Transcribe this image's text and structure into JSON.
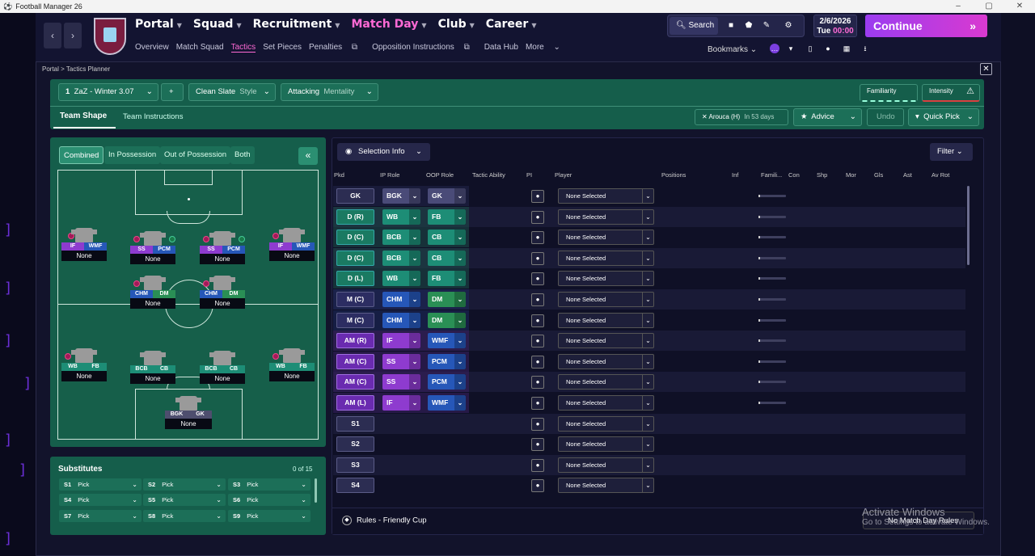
{
  "window": {
    "title": "Football Manager 26",
    "min": "–",
    "max": "▢",
    "close": "✕"
  },
  "nav": {
    "back": "‹",
    "fwd": "›",
    "main": [
      "Portal",
      "Squad",
      "Recruitment",
      "Match Day",
      "Club",
      "Career"
    ],
    "sub": [
      "Overview",
      "Match Squad",
      "Tactics",
      "Set Pieces",
      "Penalties",
      "Opposition Instructions",
      "Data Hub",
      "More"
    ]
  },
  "top": {
    "search": "Search",
    "date": "2/6/2026",
    "day": "Tue",
    "time": "00:00",
    "continue": "Continue",
    "bookmarks": "Bookmarks"
  },
  "breadcrumb": "Portal  >  Tactics Planner",
  "tactic": {
    "slot": "1",
    "name": "ZaZ - Winter 3.07",
    "add": "+",
    "style_value": "Clean Slate",
    "style_label": "Style",
    "mentality_value": "Attacking",
    "mentality_label": "Mentality",
    "familiarity": "Familiarity",
    "intensity": "Intensity"
  },
  "tabs": {
    "shape": "Team Shape",
    "instructions": "Team Instructions"
  },
  "match": {
    "opponent": "Arouca (H)",
    "when": "In 53 days"
  },
  "actions": {
    "advice": "Advice",
    "undo": "Undo",
    "quickpick": "Quick Pick"
  },
  "views": [
    "Combined",
    "In Possession",
    "Out of Possession",
    "Both"
  ],
  "pitch_players": [
    {
      "r1": "IF",
      "r2": "WMF",
      "name": "None"
    },
    {
      "r1": "SS",
      "r2": "PCM",
      "name": "None"
    },
    {
      "r1": "SS",
      "r2": "PCM",
      "name": "None"
    },
    {
      "r1": "IF",
      "r2": "WMF",
      "name": "None"
    },
    {
      "r1": "CHM",
      "r2": "DM",
      "name": "None"
    },
    {
      "r1": "CHM",
      "r2": "DM",
      "name": "None"
    },
    {
      "r1": "WB",
      "r2": "FB",
      "name": "None"
    },
    {
      "r1": "BCB",
      "r2": "CB",
      "name": "None"
    },
    {
      "r1": "BCB",
      "r2": "CB",
      "name": "None"
    },
    {
      "r1": "WB",
      "r2": "FB",
      "name": "None"
    },
    {
      "r1": "BGK",
      "r2": "GK",
      "name": "None"
    }
  ],
  "subs": {
    "title": "Substitutes",
    "count": "0 of 15",
    "pick": "Pick",
    "slots": [
      "S1",
      "S2",
      "S3",
      "S4",
      "S5",
      "S6",
      "S7",
      "S8",
      "S9"
    ]
  },
  "table": {
    "selinfo": "Selection Info",
    "filter": "Filter",
    "headers": [
      "Pkd",
      "IP Role",
      "OOP Role",
      "Tactic Ability",
      "PI",
      "Player",
      "Positions",
      "Inf",
      "Famili...",
      "Con",
      "Shp",
      "Mor",
      "Gls",
      "Ast",
      "Av Rot"
    ],
    "rows": [
      {
        "pos": "GK",
        "ip": "BGK",
        "oop": "GK",
        "player": "None Selected"
      },
      {
        "pos": "D (R)",
        "ip": "WB",
        "oop": "FB",
        "player": "None Selected"
      },
      {
        "pos": "D (C)",
        "ip": "BCB",
        "oop": "CB",
        "player": "None Selected"
      },
      {
        "pos": "D (C)",
        "ip": "BCB",
        "oop": "CB",
        "player": "None Selected"
      },
      {
        "pos": "D (L)",
        "ip": "WB",
        "oop": "FB",
        "player": "None Selected"
      },
      {
        "pos": "M (C)",
        "ip": "CHM",
        "oop": "DM",
        "player": "None Selected"
      },
      {
        "pos": "M (C)",
        "ip": "CHM",
        "oop": "DM",
        "player": "None Selected"
      },
      {
        "pos": "AM (R)",
        "ip": "IF",
        "oop": "WMF",
        "player": "None Selected"
      },
      {
        "pos": "AM (C)",
        "ip": "SS",
        "oop": "PCM",
        "player": "None Selected"
      },
      {
        "pos": "AM (C)",
        "ip": "SS",
        "oop": "PCM",
        "player": "None Selected"
      },
      {
        "pos": "AM (L)",
        "ip": "IF",
        "oop": "WMF",
        "player": "None Selected"
      },
      {
        "pos": "S1",
        "ip": "",
        "oop": "",
        "player": "None Selected"
      },
      {
        "pos": "S2",
        "ip": "",
        "oop": "",
        "player": "None Selected"
      },
      {
        "pos": "S3",
        "ip": "",
        "oop": "",
        "player": "None Selected"
      },
      {
        "pos": "S4",
        "ip": "",
        "oop": "",
        "player": "None Selected"
      }
    ]
  },
  "footer": {
    "rules": "Rules - Friendly Cup",
    "nomatch": "No Match Day Rules"
  },
  "watermark": {
    "line1": "Activate Windows",
    "line2": "Go to Settings to activate Windows."
  }
}
